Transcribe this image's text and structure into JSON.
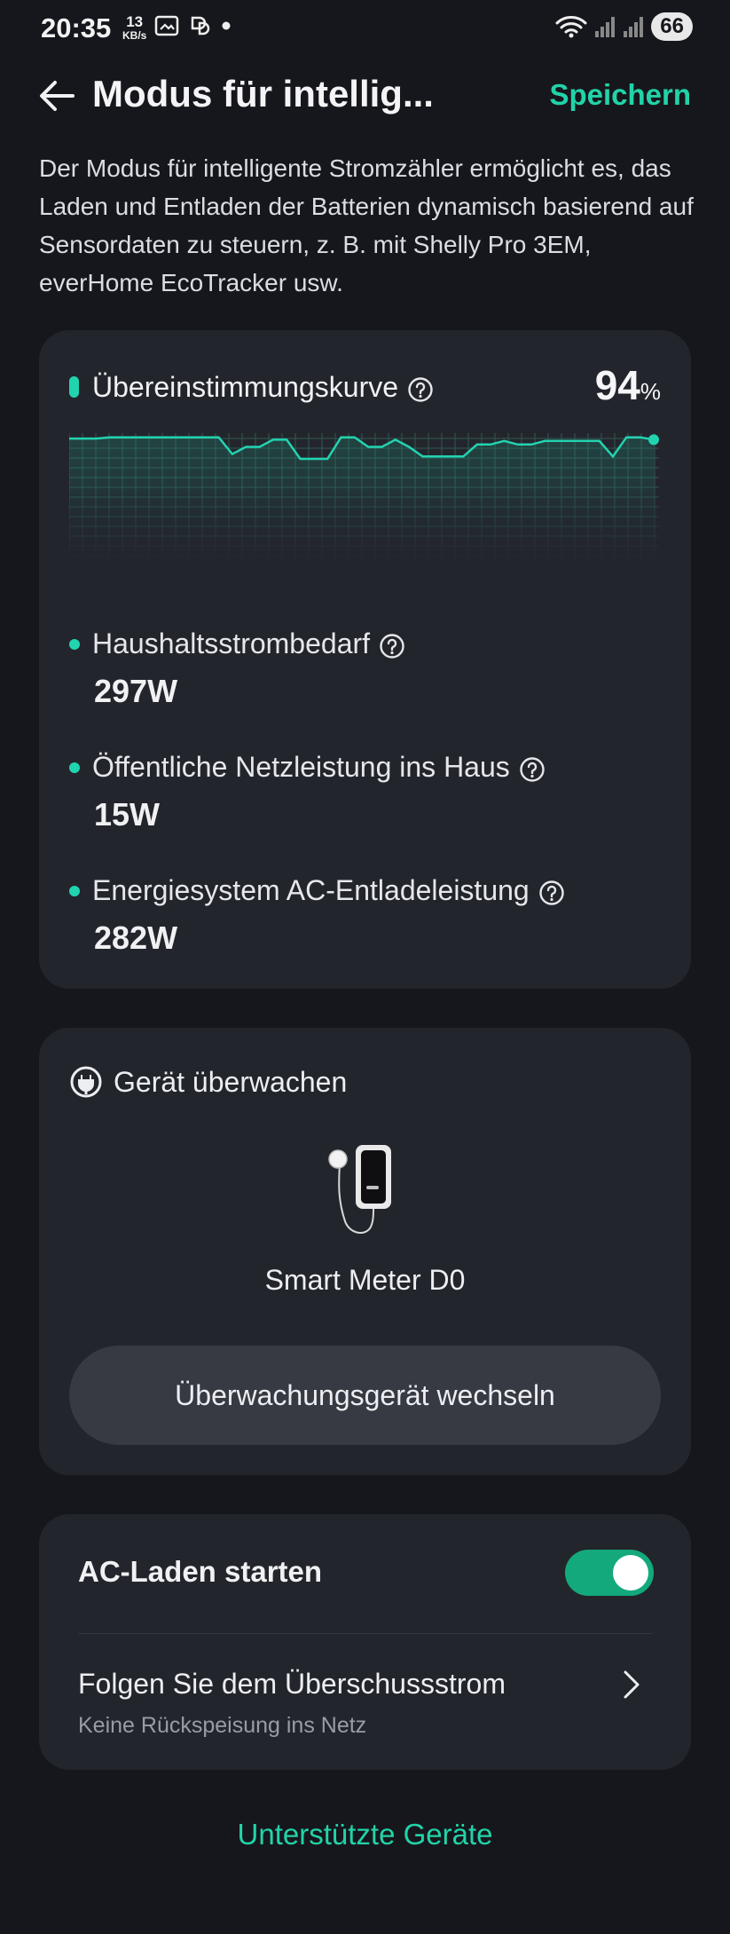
{
  "status_bar": {
    "time": "20:35",
    "net_speed_value": "13",
    "net_speed_unit": "KB/s",
    "battery": "66",
    "icons": [
      "screenshot-icon",
      "gallery-icon",
      "app-icon",
      "dot-icon",
      "wifi-icon",
      "signal-icon",
      "signal-icon",
      "battery-icon"
    ]
  },
  "header": {
    "title": "Modus für intellig...",
    "save_label": "Speichern"
  },
  "description": "Der Modus für intelligente Stromzähler ermöglicht es, das Laden und Entladen der Batterien dynamisch basierend auf Sensordaten zu steuern, z. B. mit Shelly Pro 3EM, everHome EcoTracker usw.",
  "match_card": {
    "title": "Übereinstimmungskurve",
    "percent_value": "94",
    "percent_unit": "%",
    "metrics": [
      {
        "label": "Haushaltsstrombedarf",
        "value": "297W"
      },
      {
        "label": "Öffentliche Netzleistung ins Haus",
        "value": "15W"
      },
      {
        "label": "Energiesystem AC-Entladeleistung",
        "value": "282W"
      }
    ]
  },
  "chart_data": {
    "type": "line",
    "title": "Übereinstimmungskurve",
    "values": [
      97,
      97,
      97,
      98,
      98,
      98,
      98,
      98,
      98,
      98,
      98,
      98,
      84,
      90,
      90,
      96,
      96,
      80,
      80,
      80,
      98,
      98,
      90,
      90,
      96,
      90,
      82,
      82,
      82,
      82,
      92,
      92,
      95,
      92,
      92,
      95,
      95,
      95,
      95,
      95,
      82,
      98,
      98,
      96
    ],
    "color": "#22d3b0",
    "grid": true
  },
  "monitor_card": {
    "title": "Gerät überwachen",
    "device_name": "Smart Meter D0",
    "switch_button": "Überwachungsgerät wechseln"
  },
  "settings_card": {
    "ac_charge_label": "AC-Laden starten",
    "ac_charge_on": true,
    "follow_label": "Folgen Sie dem Überschussstrom",
    "follow_sub": "Keine Rückspeisung ins Netz"
  },
  "supported_devices_link": "Unterstützte Geräte",
  "colors": {
    "background": "#16171c",
    "card": "#23252d",
    "accent": "#22d3a8",
    "toggle": "#13a97d",
    "button": "#373a43"
  }
}
